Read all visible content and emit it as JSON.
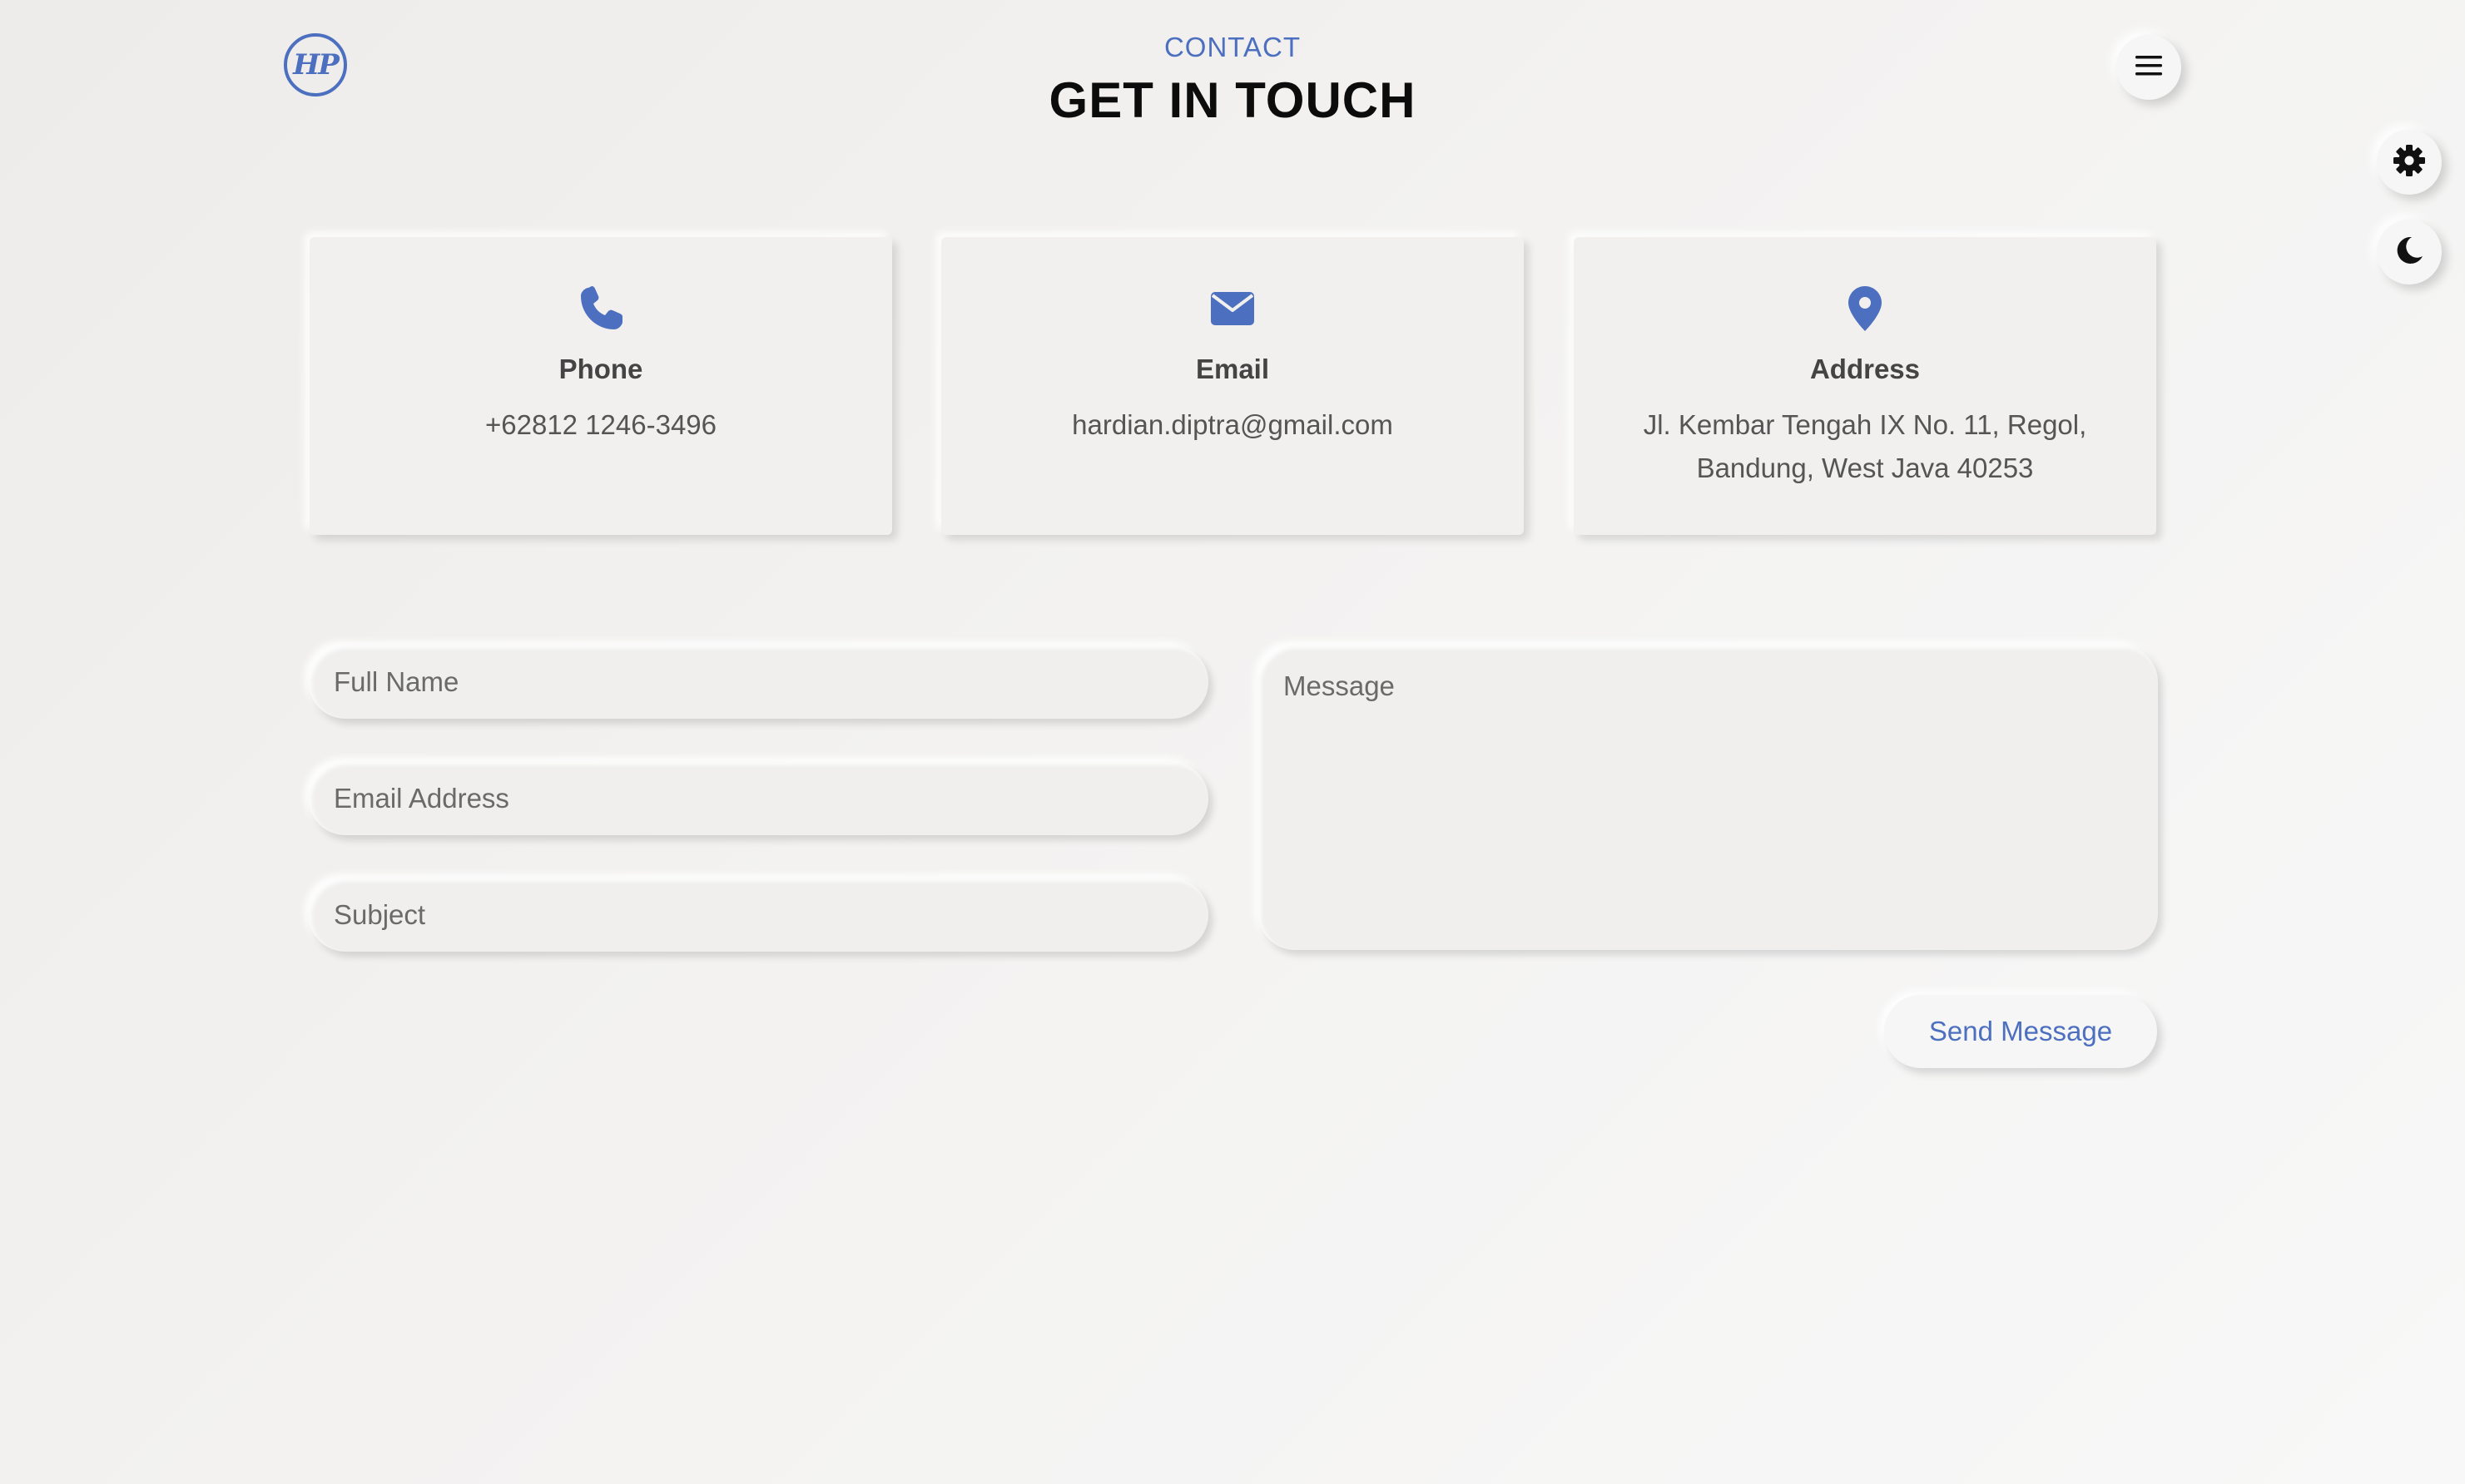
{
  "header": {
    "logo_text": "HP",
    "eyebrow": "CONTACT",
    "title": "GET IN TOUCH",
    "menu_icon": "hamburger-menu-icon"
  },
  "floating_controls": {
    "settings_icon": "gear-icon",
    "theme_icon": "moon-icon"
  },
  "contact_cards": [
    {
      "icon": "phone-icon",
      "title": "Phone",
      "value": "+62812 1246-3496"
    },
    {
      "icon": "envelope-icon",
      "title": "Email",
      "value": "hardian.diptra@gmail.com"
    },
    {
      "icon": "map-marker-icon",
      "title": "Address",
      "value": "Jl. Kembar Tengah IX No. 11, Regol, Bandung, West Java 40253"
    }
  ],
  "form": {
    "full_name_placeholder": "Full Name",
    "email_placeholder": "Email Address",
    "subject_placeholder": "Subject",
    "message_placeholder": "Message",
    "submit_label": "Send Message"
  },
  "colors": {
    "accent": "#4c6fbf",
    "background": "#f1f0ef",
    "title": "#0c0c0c",
    "text": "#555555"
  }
}
